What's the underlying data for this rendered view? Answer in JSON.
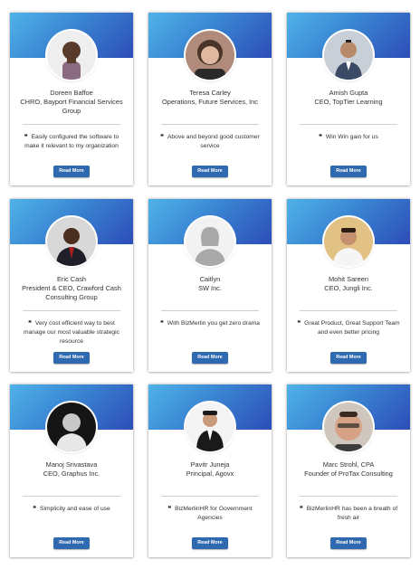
{
  "read_more_label": "Read More",
  "testimonials": [
    {
      "name": "Doreen Baffoe",
      "role": "CHRO, Bayport Financial Services Group",
      "quote": "Easily configured the software to make it relevant to my organization",
      "avatar": "person-photo-woman"
    },
    {
      "name": "Teresa Carley",
      "role": "Operations, Future Services, Inc",
      "quote": "Above and beyond good customer service",
      "avatar": "person-photo-woman"
    },
    {
      "name": "Amish Gupta",
      "role": "CEO, TopTier Learning",
      "quote": "Win Win gain for us",
      "avatar": "person-photo-man"
    },
    {
      "name": "Eric Cash",
      "role": "President & CEO, Crawford Cash Consulting Group",
      "quote": "Very cost efficient way to best manage our most valuable strategic resource",
      "avatar": "person-photo-man"
    },
    {
      "name": "Caitlyn",
      "role": "SW Inc.",
      "quote": "With BizMerlin you get zero drama",
      "avatar": "placeholder-person-icon"
    },
    {
      "name": "Mohit Sareen",
      "role": "CEO, Jungli Inc.",
      "quote": "Great Product, Great Support Team and even better pricing",
      "avatar": "person-photo-man"
    },
    {
      "name": "Manoj Srivastava",
      "role": "CEO, Graphus Inc.",
      "quote": "Simplicity and ease of use",
      "avatar": "person-photo-man"
    },
    {
      "name": "Pavitr Juneja",
      "role": "Principal, Agovx",
      "quote": "BizMerlinHR for Government Agencies",
      "avatar": "person-photo-man"
    },
    {
      "name": "Marc Strohl, CPA",
      "role": "Founder of ProTax Consulting",
      "quote": "BizMerlinHR has been a breath of fresh air",
      "avatar": "person-photo-man"
    }
  ]
}
